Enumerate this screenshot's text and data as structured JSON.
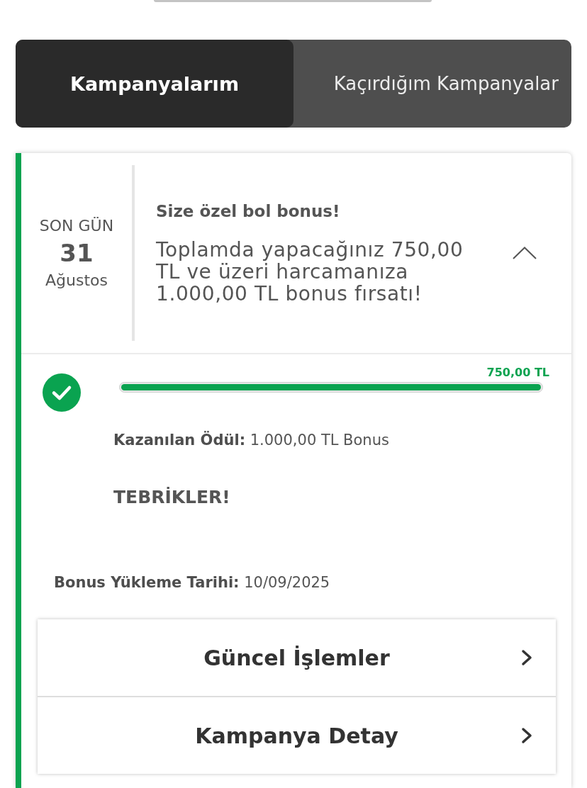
{
  "tabs": [
    {
      "label": "Kampanyalarım",
      "selected": true
    },
    {
      "label": "Kaçırdığım Kampanyalar",
      "selected": false
    }
  ],
  "campaign": {
    "deadline_label": "SON GÜN",
    "day": "31",
    "month": "Ağustos",
    "title": "Size özel bol bonus!",
    "description": "Toplamda yapacağınız 750,00 TL ve üzeri harcamanıza 1.000,00 TL bonus fırsatı!",
    "expanded": true,
    "completed": true,
    "progress": {
      "target": "750,00 TL",
      "level": 1
    },
    "reward": "**Kazanılan Ödül:** 1.000,00 TL Bonus",
    "status": "TEBRİKLER!",
    "bonus_date": "**Bonus Yükleme Tarihi:** 10/09/2025",
    "links": [
      {
        "label": "Güncel İşlemler"
      },
      {
        "label": "Kampanya Detay"
      }
    ]
  }
}
